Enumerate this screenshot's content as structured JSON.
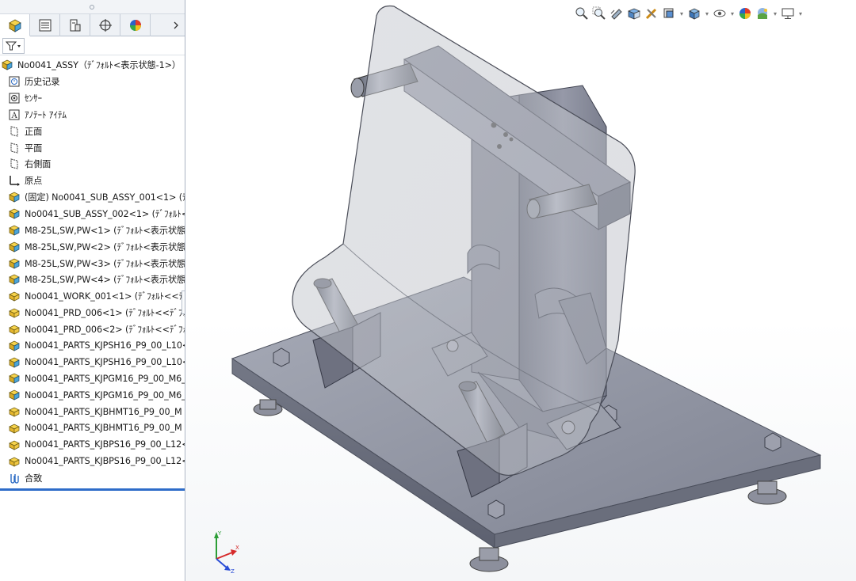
{
  "tree": {
    "root": "No0041_ASSY（ﾃﾞﾌｫﾙﾄ<表示状態-1>）",
    "items": [
      {
        "label": "历史记录",
        "icon": "history-icon"
      },
      {
        "label": "ｾﾝｻｰ",
        "icon": "sensor-icon"
      },
      {
        "label": "ｱﾉﾃｰﾄ ｱｲﾃﾑ",
        "icon": "annotation-icon"
      },
      {
        "label": "正面",
        "icon": "plane-icon"
      },
      {
        "label": "平面",
        "icon": "plane-icon"
      },
      {
        "label": "右側面",
        "icon": "plane-icon"
      },
      {
        "label": "原点",
        "icon": "origin-icon"
      },
      {
        "label": "(固定) No0041_SUB_ASSY_001<1> (ﾃﾞ",
        "icon": "subassembly-icon"
      },
      {
        "label": "No0041_SUB_ASSY_002<1> (ﾃﾞﾌｫﾙﾄ<",
        "icon": "subassembly-icon"
      },
      {
        "label": "M8-25L,SW,PW<1> (ﾃﾞﾌｫﾙﾄ<表示状態",
        "icon": "subassembly-icon"
      },
      {
        "label": "M8-25L,SW,PW<2> (ﾃﾞﾌｫﾙﾄ<表示状態",
        "icon": "subassembly-icon"
      },
      {
        "label": "M8-25L,SW,PW<3> (ﾃﾞﾌｫﾙﾄ<表示状態",
        "icon": "subassembly-icon"
      },
      {
        "label": "M8-25L,SW,PW<4> (ﾃﾞﾌｫﾙﾄ<表示状態",
        "icon": "subassembly-icon"
      },
      {
        "label": "No0041_WORK_001<1> (ﾃﾞﾌｫﾙﾄ<<ﾃﾞ",
        "icon": "part-icon"
      },
      {
        "label": "No0041_PRD_006<1> (ﾃﾞﾌｫﾙﾄ<<ﾃﾞﾌｫ",
        "icon": "part-icon"
      },
      {
        "label": "No0041_PRD_006<2> (ﾃﾞﾌｫﾙﾄ<<ﾃﾞﾌｫ",
        "icon": "part-icon"
      },
      {
        "label": "No0041_PARTS_KJPSH16_P9_00_L10<",
        "icon": "subassembly-icon"
      },
      {
        "label": "No0041_PARTS_KJPSH16_P9_00_L10<",
        "icon": "subassembly-icon"
      },
      {
        "label": "No0041_PARTS_KJPGM16_P9_00_M6_",
        "icon": "subassembly-icon"
      },
      {
        "label": "No0041_PARTS_KJPGM16_P9_00_M6_",
        "icon": "subassembly-icon"
      },
      {
        "label": "No0041_PARTS_KJBHMT16_P9_00_M",
        "icon": "part-icon"
      },
      {
        "label": "No0041_PARTS_KJBHMT16_P9_00_M",
        "icon": "part-icon"
      },
      {
        "label": "No0041_PARTS_KJBPS16_P9_00_L12<",
        "icon": "part-icon"
      },
      {
        "label": "No0041_PARTS_KJBPS16_P9_00_L12<",
        "icon": "part-icon"
      },
      {
        "label": "合致",
        "icon": "mates-icon"
      }
    ]
  },
  "triad": {
    "x": "X",
    "y": "Y",
    "z": "Z"
  },
  "colors": {
    "accent": "#2e6cc9",
    "model": "#8a8e9e",
    "glass": "#c2c6cc"
  }
}
